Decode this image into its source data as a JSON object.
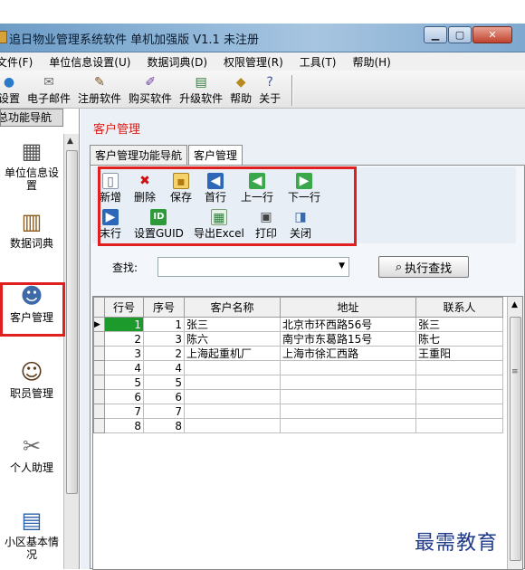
{
  "window": {
    "title": "追日物业管理系统软件 单机加强版 V1.1 未注册"
  },
  "menu": [
    "文件(F)",
    "单位信息设置(U)",
    "数据词典(D)",
    "权限管理(R)",
    "工具(T)",
    "帮助(H)"
  ],
  "toolbar": [
    {
      "label": "设置",
      "icon": "globe-icon"
    },
    {
      "label": "电子邮件",
      "icon": "mail-icon"
    },
    {
      "label": "注册软件",
      "icon": "pen-icon"
    },
    {
      "label": "购买软件",
      "icon": "cart-icon"
    },
    {
      "label": "升级软件",
      "icon": "upgrade-icon"
    },
    {
      "label": "帮助",
      "icon": "help-icon"
    },
    {
      "label": "关于",
      "icon": "about-icon"
    }
  ],
  "nav": {
    "header": "总功能导航",
    "items": [
      {
        "label": "单位信息设置",
        "icon": "building-icon"
      },
      {
        "label": "数据词典",
        "icon": "book-icon"
      },
      {
        "label": "客户管理",
        "icon": "people-icon"
      },
      {
        "label": "职员管理",
        "icon": "person-icon"
      },
      {
        "label": "个人助理",
        "icon": "tools-icon"
      },
      {
        "label": "小区基本情况",
        "icon": "keyboard-icon"
      }
    ]
  },
  "main": {
    "title": "客户管理",
    "tabs": [
      {
        "label": "客户管理功能导航"
      },
      {
        "label": "客户管理"
      }
    ],
    "actions": [
      {
        "label": "新增",
        "icon": "new-icon"
      },
      {
        "label": "删除",
        "icon": "delete-icon"
      },
      {
        "label": "保存",
        "icon": "save-icon"
      },
      {
        "label": "首行",
        "icon": "first-row-icon"
      },
      {
        "label": "上一行",
        "icon": "prev-row-icon"
      },
      {
        "label": "下一行",
        "icon": "next-row-icon"
      },
      {
        "label": "末行",
        "icon": "last-row-icon"
      },
      {
        "label": "设置GUID",
        "icon": "id-icon"
      },
      {
        "label": "导出Excel",
        "icon": "excel-icon"
      },
      {
        "label": "打印",
        "icon": "print-icon"
      },
      {
        "label": "关闭",
        "icon": "close-door-icon"
      }
    ],
    "search": {
      "label": "查找:",
      "value": "",
      "button": "执行查找"
    },
    "table": {
      "columns": [
        "行号",
        "序号",
        "客户名称",
        "地址",
        "联系人"
      ],
      "rows": [
        [
          "1",
          "1",
          "张三",
          "北京市环西路56号",
          "张三"
        ],
        [
          "2",
          "3",
          "陈六",
          "南宁市东葛路15号",
          "陈七"
        ],
        [
          "3",
          "2",
          "上海起重机厂",
          "上海市徐汇西路",
          "王重阳"
        ],
        [
          "4",
          "4",
          "",
          "",
          ""
        ],
        [
          "5",
          "5",
          "",
          "",
          ""
        ],
        [
          "6",
          "6",
          "",
          "",
          ""
        ],
        [
          "7",
          "7",
          "",
          "",
          ""
        ],
        [
          "8",
          "8",
          "",
          "",
          ""
        ]
      ]
    }
  },
  "watermark": "最需教育",
  "colors": {
    "highlight": "#e0201e",
    "title_red": "#d8201a",
    "selection": "#1c9a2c",
    "watermark": "#1f3a8a"
  }
}
